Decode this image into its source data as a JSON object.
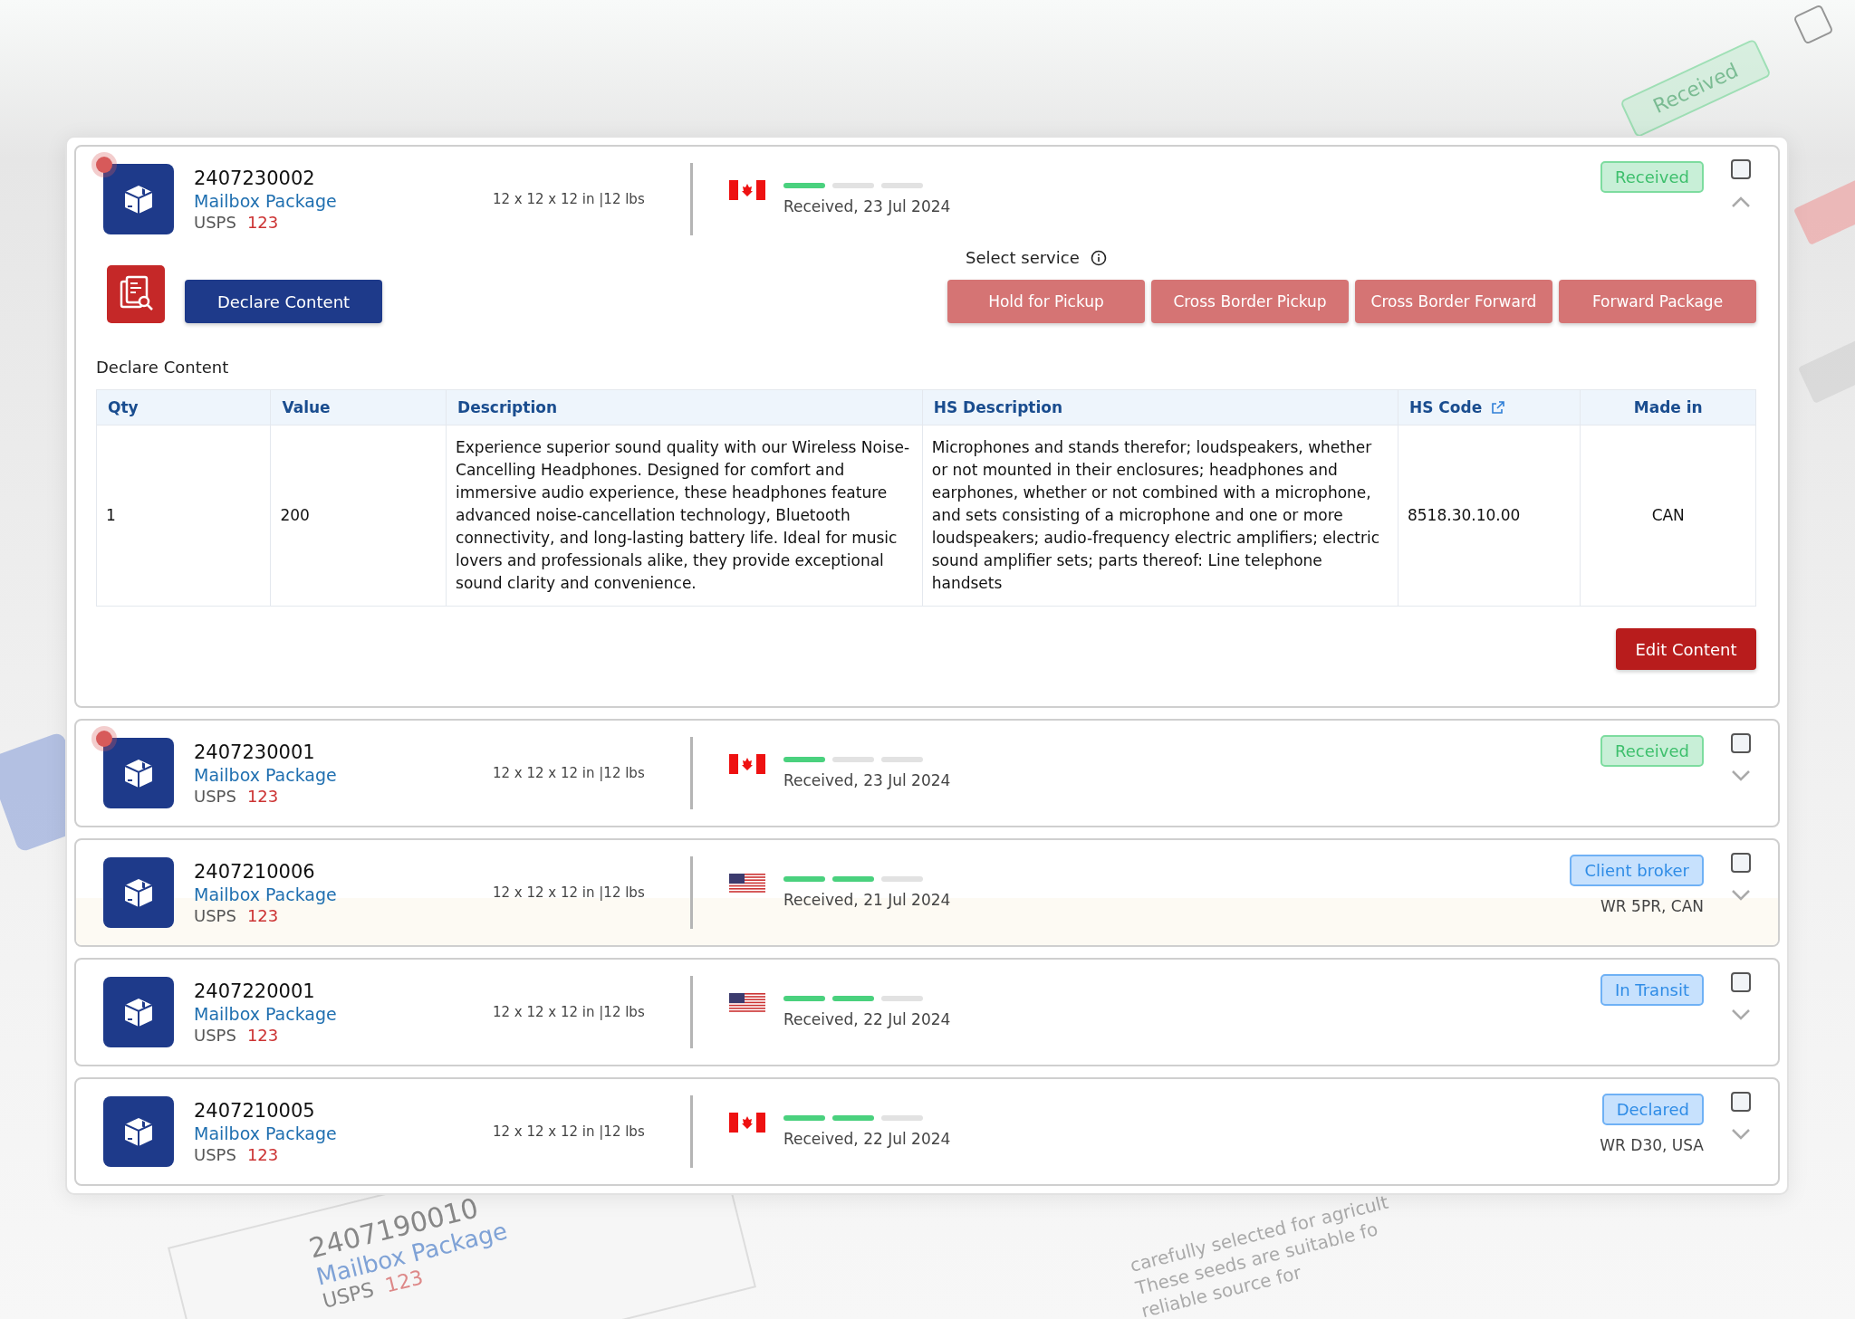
{
  "background": {
    "badge": "Received",
    "card": {
      "id": "2407190010",
      "type": "Mailbox Package",
      "carrier": "USPS",
      "code": "123"
    },
    "text_lines": [
      "carefully selected for agricult",
      "These seeds are suitable fo",
      "reliable source for"
    ]
  },
  "shipments": [
    {
      "id": "2407230002",
      "type": "Mailbox Package",
      "carrier": "USPS",
      "code": "123",
      "dimensions": "12 x 12 x 12 in |12 lbs",
      "alert": true,
      "flag": {
        "kind": "canada"
      },
      "steps": [
        {
          "done": true
        },
        {
          "done": false
        },
        {
          "done": false
        }
      ],
      "status_text": "Received, 23 Jul 2024",
      "status": {
        "label": "Received",
        "kind": "success"
      },
      "checked": false,
      "expanded": true,
      "highlighted": false
    },
    {
      "id": "2407230001",
      "type": "Mailbox Package",
      "carrier": "USPS",
      "code": "123",
      "dimensions": "12 x 12 x 12 in |12 lbs",
      "alert": true,
      "flag": {
        "kind": "canada"
      },
      "steps": [
        {
          "done": true
        },
        {
          "done": false
        },
        {
          "done": false
        }
      ],
      "status_text": "Received, 23 Jul 2024",
      "status": {
        "label": "Received",
        "kind": "success"
      },
      "checked": false,
      "expanded": false,
      "highlighted": false
    },
    {
      "id": "2407210006",
      "type": "Mailbox Package",
      "carrier": "USPS",
      "code": "123",
      "dimensions": "12 x 12 x 12 in |12 lbs",
      "alert": false,
      "flag": {
        "kind": "usa"
      },
      "steps": [
        {
          "done": true
        },
        {
          "done": true
        },
        {
          "done": false
        }
      ],
      "status_text": "Received, 21 Jul 2024",
      "status": {
        "label": "Client broker",
        "kind": "info"
      },
      "location": "WR 5PR, CAN",
      "checked": false,
      "expanded": false,
      "highlighted": true
    },
    {
      "id": "2407220001",
      "type": "Mailbox Package",
      "carrier": "USPS",
      "code": "123",
      "dimensions": "12 x 12 x 12 in |12 lbs",
      "alert": false,
      "flag": {
        "kind": "usa"
      },
      "steps": [
        {
          "done": true
        },
        {
          "done": true
        },
        {
          "done": false
        }
      ],
      "status_text": "Received, 22 Jul 2024",
      "status": {
        "label": "In Transit",
        "kind": "info"
      },
      "checked": false,
      "expanded": false,
      "highlighted": false
    },
    {
      "id": "2407210005",
      "type": "Mailbox Package",
      "carrier": "USPS",
      "code": "123",
      "dimensions": "12 x 12 x 12 in |12 lbs",
      "alert": false,
      "flag": {
        "kind": "canada"
      },
      "steps": [
        {
          "done": true
        },
        {
          "done": true
        },
        {
          "done": false
        }
      ],
      "status_text": "Received, 22 Jul 2024",
      "status": {
        "label": "Declared",
        "kind": "info"
      },
      "location": "WR D30, USA",
      "checked": false,
      "expanded": false,
      "highlighted": false
    }
  ],
  "details": {
    "declare_button": "Declare Content",
    "service_label": "Select service",
    "services": [
      "Hold for Pickup",
      "Cross Border Pickup",
      "Cross Border Forward",
      "Forward Package"
    ],
    "section_title": "Declare Content",
    "table": {
      "columns": [
        "Qty",
        "Value",
        "Description",
        "HS Description",
        "HS Code",
        "Made in"
      ],
      "rows": [
        [
          "1",
          "200",
          "Experience superior sound quality with our Wireless Noise-Cancelling Headphones. Designed for comfort and immersive audio experience, these headphones feature advanced noise-cancellation technology, Bluetooth connectivity, and long-lasting battery life. Ideal for music lovers and professionals alike, they provide exceptional sound clarity and convenience.",
          "Microphones and stands therefor; loudspeakers, whether or not mounted in their enclosures; headphones and earphones, whether or not combined with a microphone, and sets consisting of a microphone and one or more loudspeakers; audio-frequency electric amplifiers; electric sound amplifier sets; parts thereof: Line telephone handsets",
          "8518.30.10.00",
          "CAN"
        ]
      ]
    },
    "edit_button": "Edit Content"
  }
}
